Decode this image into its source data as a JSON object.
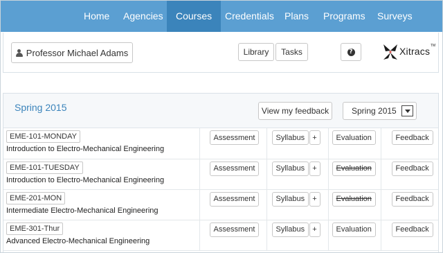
{
  "nav": {
    "items": [
      "Home",
      "Agencies",
      "Courses",
      "Credentials",
      "Plans",
      "Programs",
      "Surveys"
    ],
    "active": "Courses"
  },
  "header": {
    "user_name": "Professor Michael Adams",
    "library_label": "Library",
    "tasks_label": "Tasks",
    "help_label": "?",
    "logo_text": "Xitracs",
    "logo_tm": "TM"
  },
  "panel": {
    "term_title": "Spring 2015",
    "feedback_label": "View my feedback",
    "term_select_value": "Spring 2015"
  },
  "courses": [
    {
      "code": "EME-101-MONDAY",
      "name": "Introduction to Electro-Mechanical Engineering",
      "assessment": "Assessment",
      "syllabus": "Syllabus",
      "add": "+",
      "evaluation": "Evaluation",
      "evaluation_struck": false,
      "feedback": "Feedback"
    },
    {
      "code": "EME-101-TUESDAY",
      "name": "Introduction to Electro-Mechanical Engineering",
      "assessment": "Assessment",
      "syllabus": "Syllabus",
      "add": "+",
      "evaluation": "Evaluation",
      "evaluation_struck": true,
      "feedback": "Feedback"
    },
    {
      "code": "EME-201-MON",
      "name": "Intermediate Electro-Mechanical Engineering",
      "assessment": "Assessment",
      "syllabus": "Syllabus",
      "add": "+",
      "evaluation": "Evaluation",
      "evaluation_struck": true,
      "feedback": "Feedback"
    },
    {
      "code": "EME-301-Thur",
      "name": "Advanced Electro-Mechanical Engineering",
      "assessment": "Assessment",
      "syllabus": "Syllabus",
      "add": "+",
      "evaluation": "Evaluation",
      "evaluation_struck": false,
      "feedback": "Feedback"
    }
  ],
  "colors": {
    "nav_bg": "#5b9fd2",
    "nav_active": "#3b84bb",
    "title_blue": "#3b84bb"
  }
}
